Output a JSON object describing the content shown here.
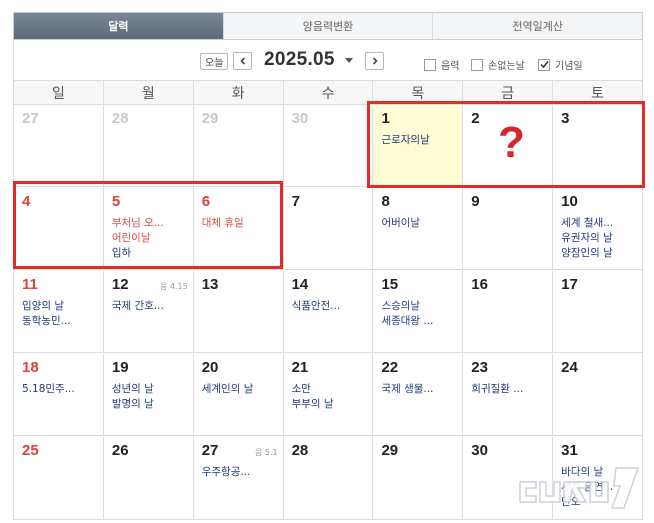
{
  "tabs": [
    {
      "label": "달력",
      "active": true
    },
    {
      "label": "양음력변환",
      "active": false
    },
    {
      "label": "전역일계산",
      "active": false
    }
  ],
  "toolbar": {
    "today_label": "오늘",
    "month_title": "2025.05",
    "options": [
      {
        "label": "음력",
        "checked": false
      },
      {
        "label": "손없는날",
        "checked": false
      },
      {
        "label": "기념일",
        "checked": true
      }
    ]
  },
  "weekdays": [
    "일",
    "월",
    "화",
    "수",
    "목",
    "금",
    "토"
  ],
  "weeks": [
    [
      {
        "day": "27",
        "muted": true,
        "events": []
      },
      {
        "day": "28",
        "muted": true,
        "events": []
      },
      {
        "day": "29",
        "muted": true,
        "events": []
      },
      {
        "day": "30",
        "muted": true,
        "events": []
      },
      {
        "day": "1",
        "today": true,
        "events": [
          {
            "text": "근로자의날"
          }
        ]
      },
      {
        "day": "2",
        "events": []
      },
      {
        "day": "3",
        "events": []
      }
    ],
    [
      {
        "day": "4",
        "red": true,
        "events": []
      },
      {
        "day": "5",
        "red": true,
        "events": [
          {
            "text": "부처님 오...",
            "red": true
          },
          {
            "text": "어린이날",
            "red": true
          },
          {
            "text": "입하"
          }
        ]
      },
      {
        "day": "6",
        "red": true,
        "events": [
          {
            "text": "대체 휴일",
            "red": true
          }
        ]
      },
      {
        "day": "7",
        "events": []
      },
      {
        "day": "8",
        "events": [
          {
            "text": "어버이날"
          }
        ]
      },
      {
        "day": "9",
        "events": []
      },
      {
        "day": "10",
        "events": [
          {
            "text": "세계 철새..."
          },
          {
            "text": "유권자의 날"
          },
          {
            "text": "양잠인의 날"
          }
        ]
      }
    ],
    [
      {
        "day": "11",
        "red": true,
        "events": [
          {
            "text": "입양의 날"
          },
          {
            "text": "동학농민..."
          }
        ]
      },
      {
        "day": "12",
        "lunar": "음 4.15",
        "events": [
          {
            "text": "국제 간호..."
          }
        ]
      },
      {
        "day": "13",
        "events": []
      },
      {
        "day": "14",
        "events": [
          {
            "text": "식품안전..."
          }
        ]
      },
      {
        "day": "15",
        "events": [
          {
            "text": "스승의날"
          },
          {
            "text": "세종대왕 ..."
          }
        ]
      },
      {
        "day": "16",
        "events": []
      },
      {
        "day": "17",
        "events": []
      }
    ],
    [
      {
        "day": "18",
        "red": true,
        "events": [
          {
            "text": "5.18민주..."
          }
        ]
      },
      {
        "day": "19",
        "events": [
          {
            "text": "성년의 날"
          },
          {
            "text": "발명의 날"
          }
        ]
      },
      {
        "day": "20",
        "events": [
          {
            "text": "세계인의 날"
          }
        ]
      },
      {
        "day": "21",
        "events": [
          {
            "text": "소만"
          },
          {
            "text": "부부의 날"
          }
        ]
      },
      {
        "day": "22",
        "events": [
          {
            "text": "국제 생물..."
          }
        ]
      },
      {
        "day": "23",
        "events": [
          {
            "text": "희귀질환 ..."
          }
        ]
      },
      {
        "day": "24",
        "events": []
      }
    ],
    [
      {
        "day": "25",
        "red": true,
        "events": []
      },
      {
        "day": "26",
        "events": []
      },
      {
        "day": "27",
        "lunar": "음 5.1",
        "events": [
          {
            "text": "우주항공..."
          }
        ]
      },
      {
        "day": "28",
        "events": []
      },
      {
        "day": "29",
        "events": []
      },
      {
        "day": "30",
        "events": []
      },
      {
        "day": "31",
        "events": [
          {
            "text": "바다의 날"
          },
          {
            "text": "세계 금연..."
          },
          {
            "text": "단오"
          }
        ]
      }
    ]
  ],
  "annotation": {
    "question_mark": "?"
  },
  "watermark": {
    "text": "뉴스1"
  },
  "colors": {
    "highlight": "#e32b2b",
    "holiday": "#e0413a",
    "event": "#223a7a",
    "today_bg": "#fffdd6"
  }
}
